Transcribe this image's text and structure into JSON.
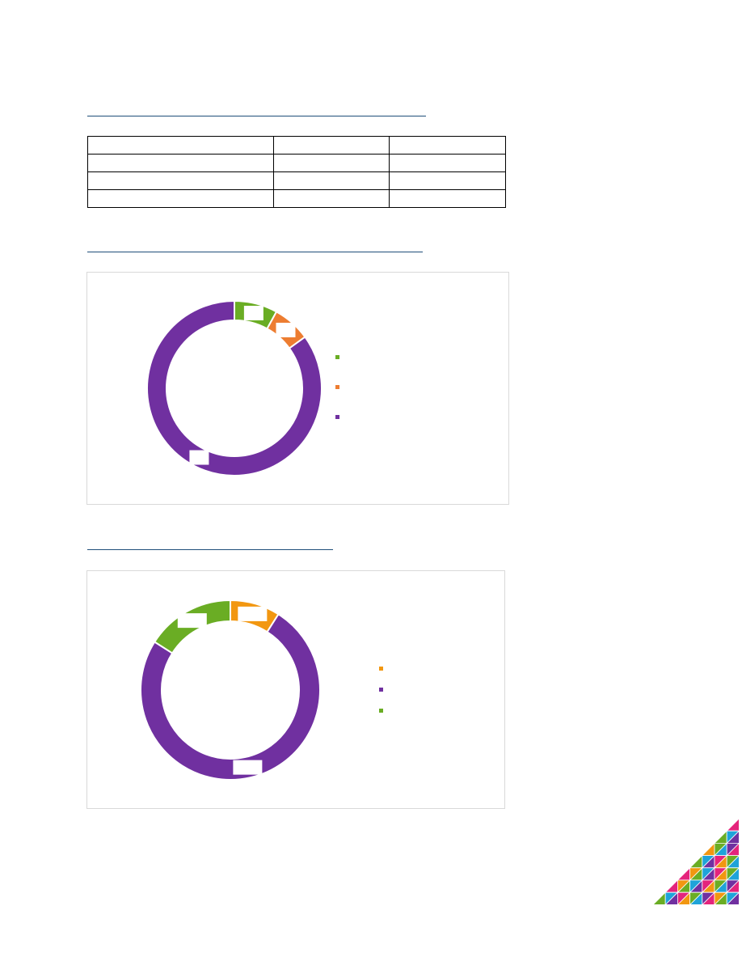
{
  "table": {
    "rows": [
      [
        "",
        "",
        ""
      ],
      [
        "",
        "",
        ""
      ],
      [
        "",
        "",
        ""
      ],
      [
        "",
        "",
        ""
      ]
    ]
  },
  "chart_data": [
    {
      "type": "pie",
      "donut": true,
      "values": [
        8,
        7,
        85
      ],
      "colors": [
        "#6aad24",
        "#ed7d31",
        "#7030a0"
      ],
      "legend": "right"
    },
    {
      "type": "pie",
      "donut": true,
      "values": [
        9,
        75,
        16
      ],
      "colors": [
        "#f29711",
        "#7030a0",
        "#6aad24"
      ],
      "legend": "right"
    }
  ],
  "logo": {
    "colors": [
      "#e4247c",
      "#6aad24",
      "#7030a0",
      "#f29711",
      "#1fa3d9"
    ]
  }
}
